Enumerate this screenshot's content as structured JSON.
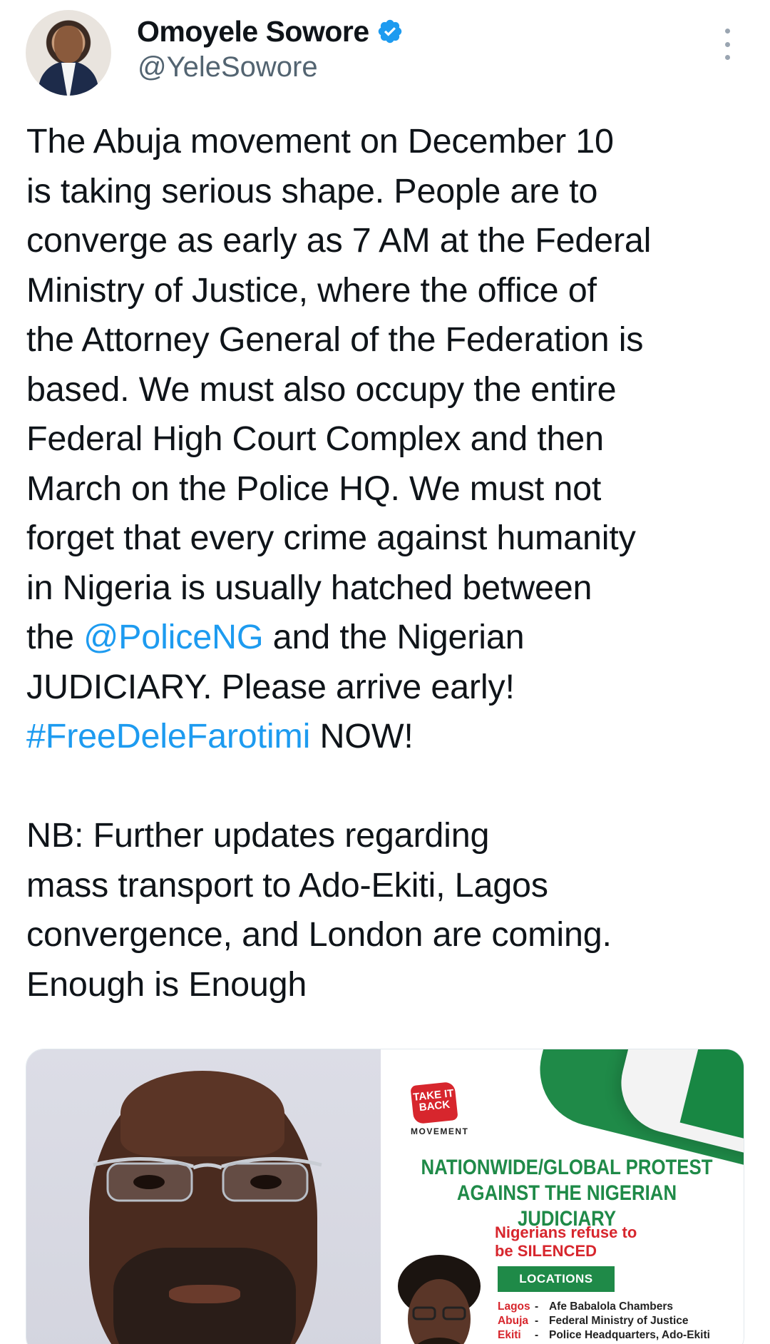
{
  "author": {
    "display_name": "Omoyele Sowore",
    "handle": "@YeleSowore",
    "verified": true
  },
  "tweet": {
    "lines": [
      [
        {
          "text": "The Abuja movement on December 10"
        }
      ],
      [
        {
          "text": "is taking serious shape. People are to"
        }
      ],
      [
        {
          "text": "converge as early as 7 AM at the Federal"
        }
      ],
      [
        {
          "text": "Ministry of Justice, where the office of"
        }
      ],
      [
        {
          "text": "the Attorney General of the Federation is"
        }
      ],
      [
        {
          "text": "based. We must also occupy the entire"
        }
      ],
      [
        {
          "text": "Federal High Court Complex and then"
        }
      ],
      [
        {
          "text": "March on the Police HQ. We must not"
        }
      ],
      [
        {
          "text": "forget that every crime against humanity"
        }
      ],
      [
        {
          "text": "in Nigeria is usually hatched between"
        }
      ],
      [
        {
          "text": "the "
        },
        {
          "text": "@PoliceNG",
          "link": true
        },
        {
          "text": " and the Nigerian"
        }
      ],
      [
        {
          "text": "JUDICIARY. Please arrive early!"
        }
      ],
      [
        {
          "text": "#FreeDeleFarotimi",
          "link": true
        },
        {
          "text": " NOW!"
        }
      ],
      [
        {
          "text": ""
        }
      ],
      [
        {
          "text": "NB: Further updates regarding"
        }
      ],
      [
        {
          "text": "mass transport to Ado-Ekiti, Lagos"
        }
      ],
      [
        {
          "text": "convergence, and London are coming."
        }
      ],
      [
        {
          "text": "Enough is Enough"
        }
      ]
    ]
  },
  "poster": {
    "logo_text": "TAKE IT BACK",
    "logo_sub": "MOVEMENT",
    "title_line1": "NATIONWIDE/GLOBAL PROTEST",
    "title_line2": "AGAINST THE NIGERIAN JUDICIARY",
    "subtitle_line1": "Nigerians refuse to",
    "subtitle_line2": "be SILENCED",
    "locations_label": "LOCATIONS",
    "locations": [
      {
        "city": "Lagos",
        "place": "Afe Babalola Chambers"
      },
      {
        "city": "Abuja",
        "place": "Federal Ministry of Justice"
      },
      {
        "city": "Ekiti",
        "place": "Police Headquarters, Ado-Ekiti"
      }
    ]
  },
  "colors": {
    "link": "#1d9bf0",
    "text": "#0f1419",
    "muted": "#536471",
    "verified": "#1d9bf0",
    "poster_green": "#1f8a48",
    "poster_red": "#d7262d"
  },
  "icons": {
    "verified": "verified-badge-icon",
    "more": "more-vertical-icon"
  }
}
